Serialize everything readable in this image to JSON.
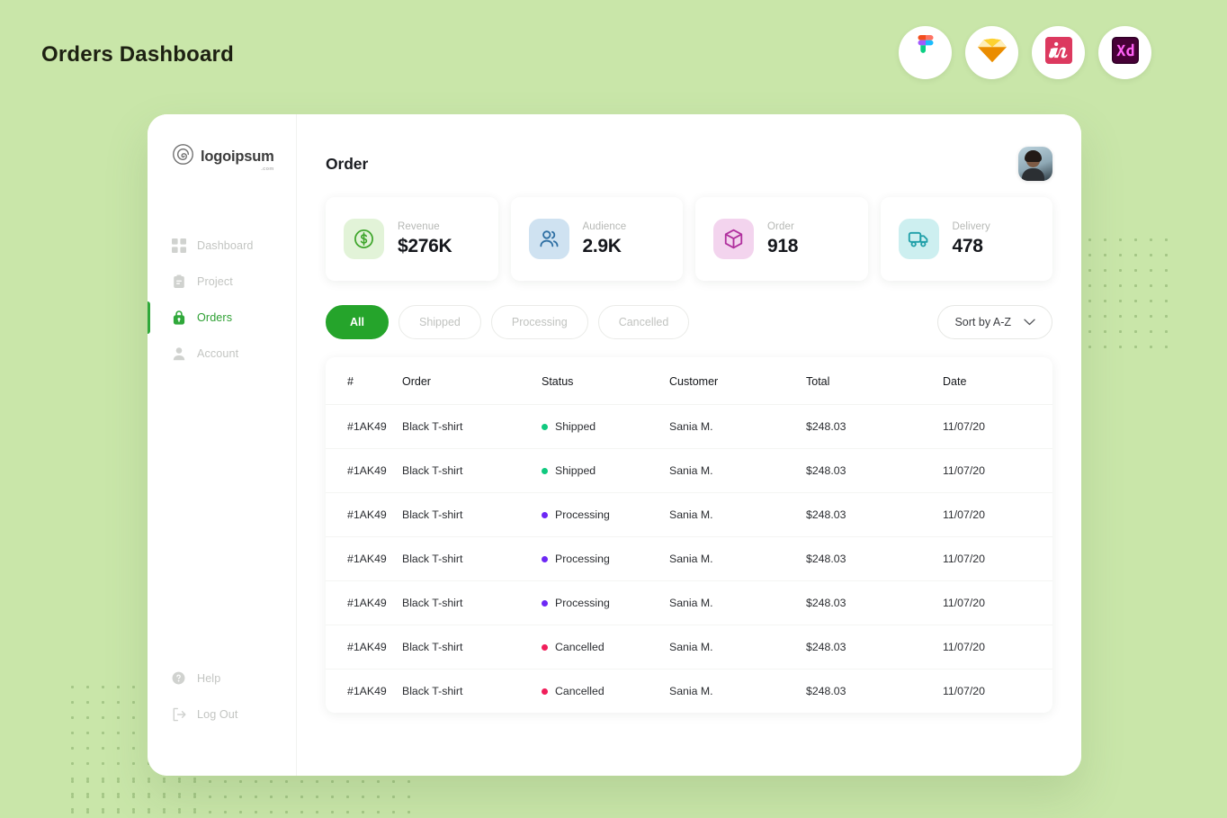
{
  "page": {
    "title": "Orders Dashboard",
    "background_color": "#c9e6a9",
    "accent_color": "#25a42b"
  },
  "app_badges": [
    {
      "name": "figma-badge",
      "label": "Figma"
    },
    {
      "name": "sketch-badge",
      "label": "Sketch"
    },
    {
      "name": "invision-badge",
      "label": "InVision"
    },
    {
      "name": "adobexd-badge",
      "label": "Adobe XD"
    }
  ],
  "sidebar": {
    "brand": {
      "name": "logoipsum",
      "tld": ".com"
    },
    "items": [
      {
        "label": "Dashboard",
        "icon": "grid-icon",
        "active": false
      },
      {
        "label": "Project",
        "icon": "clipboard-icon",
        "active": false
      },
      {
        "label": "Orders",
        "icon": "lock-bag-icon",
        "active": true
      },
      {
        "label": "Account",
        "icon": "user-icon",
        "active": false
      }
    ],
    "bottom_items": [
      {
        "label": "Help",
        "icon": "question-circle-icon"
      },
      {
        "label": "Log Out",
        "icon": "logout-icon"
      }
    ]
  },
  "main": {
    "heading": "Order",
    "avatar_alt": "User avatar"
  },
  "stats": [
    {
      "label": "Revenue",
      "value": "$276K",
      "icon": "dollar-circle-icon",
      "icon_color": "#3fa62c",
      "icon_bg": "#e2f3d8"
    },
    {
      "label": "Audience",
      "value": "2.9K",
      "icon": "people-icon",
      "icon_color": "#2e6fa3",
      "icon_bg": "#cfe2f1"
    },
    {
      "label": "Order",
      "value": "918",
      "icon": "box-icon",
      "icon_color": "#b0309e",
      "icon_bg": "#f3d4ee"
    },
    {
      "label": "Delivery",
      "value": "478",
      "icon": "truck-icon",
      "icon_color": "#1f9fa8",
      "icon_bg": "#cdeff0"
    }
  ],
  "filters": {
    "pills": [
      {
        "label": "All",
        "active": true
      },
      {
        "label": "Shipped",
        "active": false
      },
      {
        "label": "Processing",
        "active": false
      },
      {
        "label": "Cancelled",
        "active": false
      }
    ],
    "sort": {
      "label": "Sort by A-Z",
      "icon": "chevron-down-icon"
    }
  },
  "table": {
    "columns": [
      "#",
      "Order",
      "Status",
      "Customer",
      "Total",
      "Date"
    ],
    "status_colors": {
      "Shipped": "#10c97f",
      "Processing": "#6d28f5",
      "Cancelled": "#f01e5a"
    },
    "rows": [
      {
        "id": "#1AK49",
        "order": "Black T-shirt",
        "status": "Shipped",
        "customer": "Sania M.",
        "total": "$248.03",
        "date": "11/07/20"
      },
      {
        "id": "#1AK49",
        "order": "Black T-shirt",
        "status": "Shipped",
        "customer": "Sania M.",
        "total": "$248.03",
        "date": "11/07/20"
      },
      {
        "id": "#1AK49",
        "order": "Black T-shirt",
        "status": "Processing",
        "customer": "Sania M.",
        "total": "$248.03",
        "date": "11/07/20"
      },
      {
        "id": "#1AK49",
        "order": "Black T-shirt",
        "status": "Processing",
        "customer": "Sania M.",
        "total": "$248.03",
        "date": "11/07/20"
      },
      {
        "id": "#1AK49",
        "order": "Black T-shirt",
        "status": "Processing",
        "customer": "Sania M.",
        "total": "$248.03",
        "date": "11/07/20"
      },
      {
        "id": "#1AK49",
        "order": "Black T-shirt",
        "status": "Cancelled",
        "customer": "Sania M.",
        "total": "$248.03",
        "date": "11/07/20"
      },
      {
        "id": "#1AK49",
        "order": "Black T-shirt",
        "status": "Cancelled",
        "customer": "Sania M.",
        "total": "$248.03",
        "date": "11/07/20"
      }
    ]
  }
}
